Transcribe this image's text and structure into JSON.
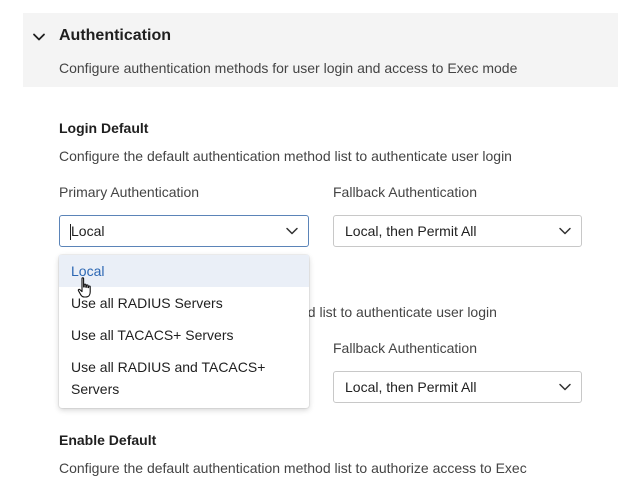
{
  "section": {
    "title": "Authentication",
    "description": "Configure authentication methods for user login and access to Exec mode"
  },
  "login_default": {
    "title": "Login Default",
    "description": "Configure the default authentication method list to authenticate user login",
    "primary_label": "Primary Authentication",
    "primary_value": "Local",
    "fallback_label": "Fallback Authentication",
    "fallback_value": "Local, then Permit All"
  },
  "dropdown": {
    "options": [
      "Local",
      "Use all RADIUS Servers",
      "Use all TACACS+ Servers",
      "Use all RADIUS and TACACS+",
      "Servers"
    ]
  },
  "second_group": {
    "description_partial": "od list to authenticate user login",
    "fallback_label": "Fallback Authentication",
    "fallback_value": "Local, then Permit All"
  },
  "enable_default": {
    "title": "Enable Default",
    "description": "Configure the default authentication method list to authorize access to Exec"
  },
  "colors": {
    "accent": "#2c67b3",
    "focus_border": "#5b84b8",
    "highlight_bg": "#eaeff7",
    "header_bg": "#f4f4f4"
  }
}
